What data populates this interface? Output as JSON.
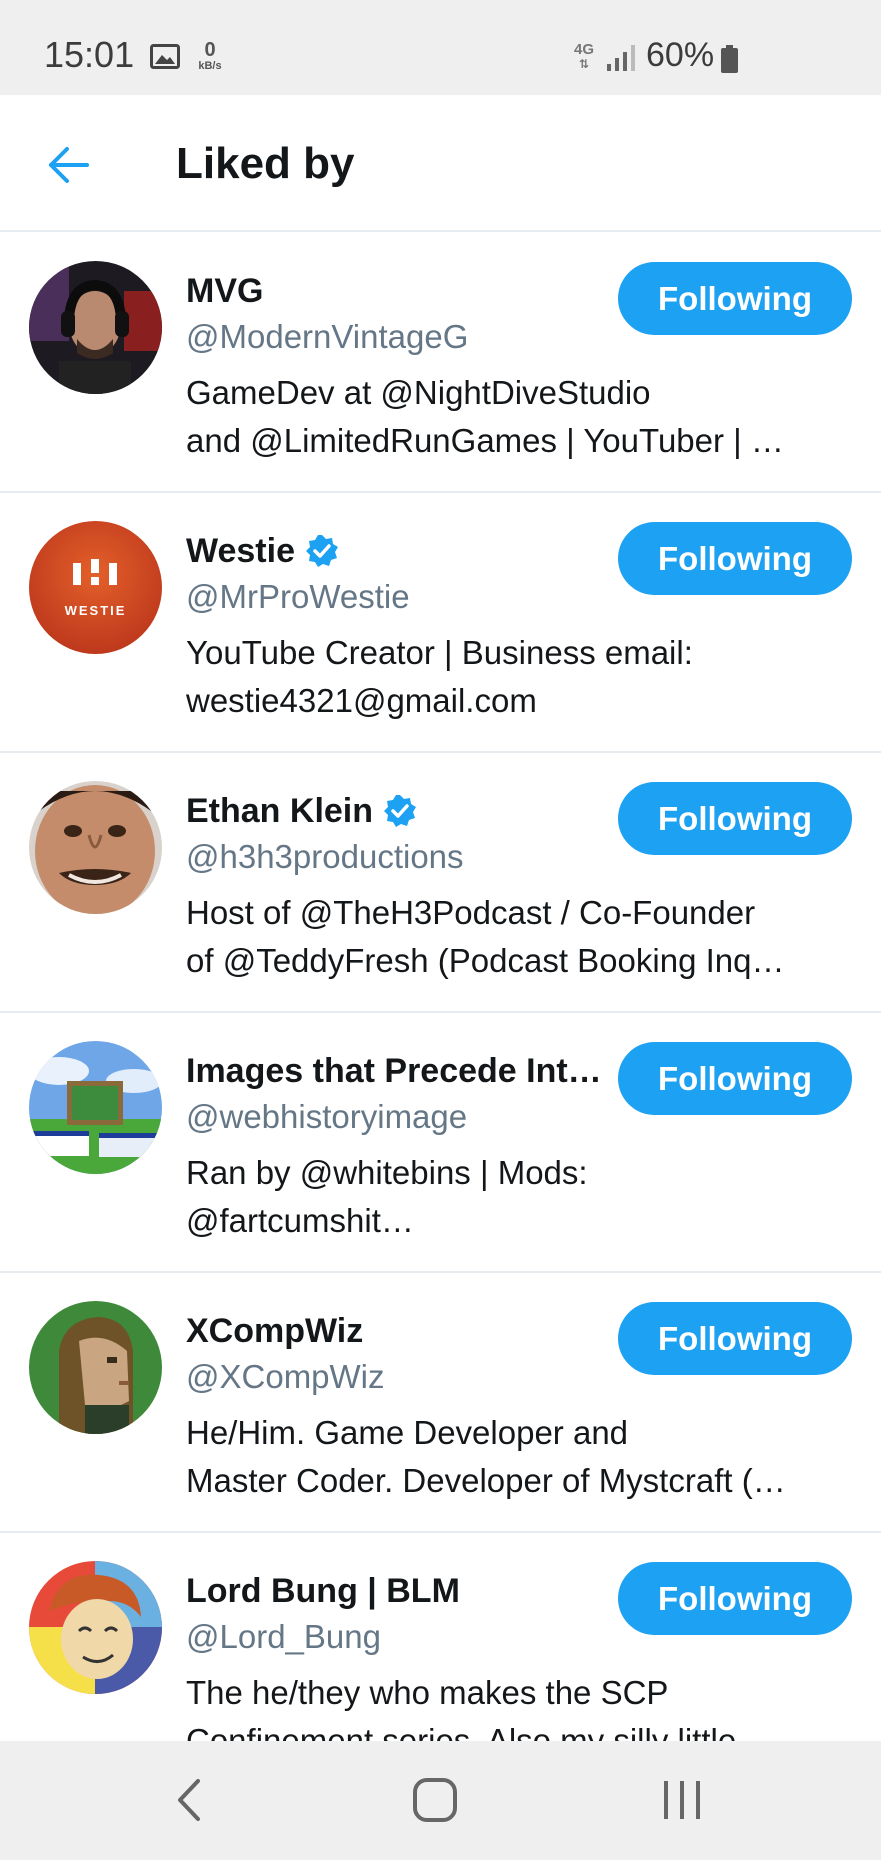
{
  "status_bar": {
    "time": "15:01",
    "net_speed_value": "0",
    "net_speed_unit": "kB/s",
    "network_type": "4G",
    "battery": "60%"
  },
  "header": {
    "title": "Liked by",
    "back_icon": "arrow-left-icon"
  },
  "colors": {
    "accent": "#1da1f2",
    "handle": "#657786",
    "text": "#14171a",
    "divider": "#e6ecf0"
  },
  "users": [
    {
      "name": "MVG",
      "handle": "@ModernVintageG",
      "verified": false,
      "bio_line1": "GameDev at @NightDiveStudio",
      "bio_line2": "and @LimitedRunGames | YouTuber | …",
      "button": "Following"
    },
    {
      "name": "Westie",
      "handle": "@MrProWestie",
      "verified": true,
      "bio_line1": "YouTube Creator | Business email:",
      "bio_line2": "westie4321@gmail.com",
      "button": "Following",
      "avatar_text": "WESTIE"
    },
    {
      "name": "Ethan Klein",
      "handle": "@h3h3productions",
      "verified": true,
      "bio_line1": "Host of @TheH3Podcast / Co-Founder",
      "bio_line2": "of @TeddyFresh (Podcast Booking Inq…",
      "button": "Following"
    },
    {
      "name": "Images that Precede Int…",
      "handle": "@webhistoryimage",
      "verified": false,
      "bio_line1": "Ran by @whitebins | Mods:",
      "bio_line2": "@fartcumshit…",
      "button": "Following"
    },
    {
      "name": "XCompWiz",
      "handle": "@XCompWiz",
      "verified": false,
      "bio_line1": "He/Him. Game Developer and",
      "bio_line2": "Master Coder. Developer of Mystcraft (…",
      "button": "Following"
    },
    {
      "name": "Lord Bung | BLM",
      "handle": "@Lord_Bung",
      "verified": false,
      "bio_line1": "The he/they who makes the SCP",
      "bio_line2": "Confinement series. Also my silly little",
      "button": "Following"
    }
  ],
  "nav_bar": {
    "back_icon": "nav-back-icon",
    "home_icon": "nav-home-icon",
    "recents_icon": "nav-recents-icon"
  }
}
